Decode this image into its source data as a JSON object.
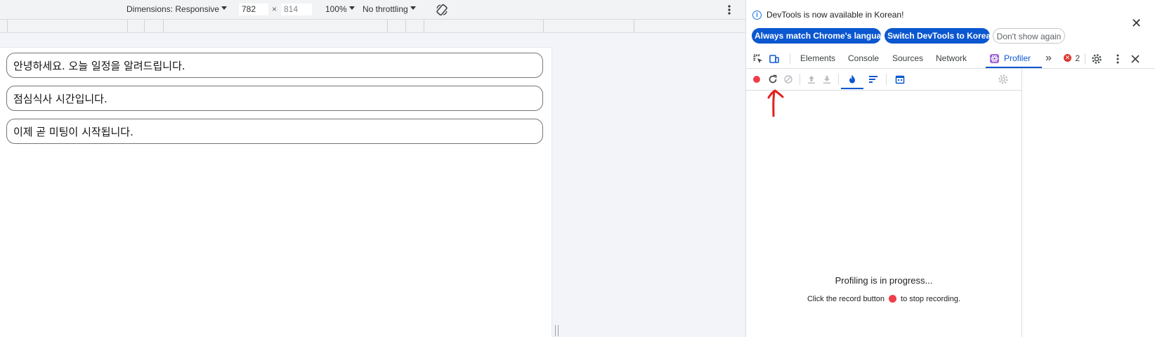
{
  "device_toolbar": {
    "dimensions_label": "Dimensions: Responsive",
    "width_value": "782",
    "times": "×",
    "height_value": "814",
    "zoom": "100%",
    "throttling": "No throttling"
  },
  "page": {
    "messages": [
      "안녕하세요. 오늘 일정을 알려드립니다.",
      "점심식사 시간입니다.",
      "이제 곧 미팅이 시작됩니다."
    ]
  },
  "infobar": {
    "text": "DevTools is now available in Korean!",
    "btn_match": "Always match Chrome's language",
    "btn_switch": "Switch DevTools to Korean",
    "btn_dismiss": "Don't show again"
  },
  "tabs": {
    "elements": "Elements",
    "console": "Console",
    "sources": "Sources",
    "network": "Network",
    "profiler": "Profiler",
    "more": "»",
    "error_count": "2"
  },
  "profiler": {
    "title": "Profiling is in progress...",
    "hint_before": "Click the record button",
    "hint_after": "to stop recording."
  },
  "colors": {
    "accent": "#0b57d0",
    "record": "#ef3d4b",
    "annotation": "#e0201b"
  }
}
